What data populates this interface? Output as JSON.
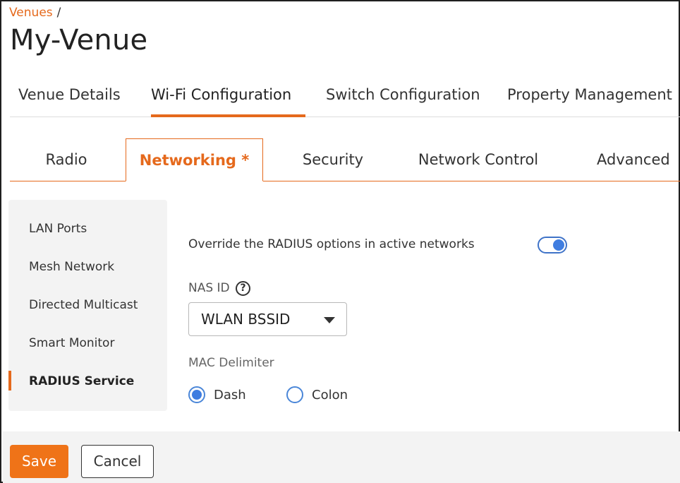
{
  "breadcrumb": {
    "items": [
      "Venues"
    ],
    "separator": "/"
  },
  "page_title": "My-Venue",
  "main_tabs": {
    "items": [
      {
        "label": "Venue Details"
      },
      {
        "label": "Wi-Fi Configuration"
      },
      {
        "label": "Switch Configuration"
      },
      {
        "label": "Property Management"
      }
    ],
    "active_index": 1
  },
  "sub_tabs": {
    "items": [
      {
        "label": "Radio"
      },
      {
        "label": "Networking *"
      },
      {
        "label": "Security"
      },
      {
        "label": "Network Control"
      },
      {
        "label": "Advanced"
      }
    ],
    "active_index": 1
  },
  "side_menu": {
    "items": [
      {
        "label": "LAN Ports"
      },
      {
        "label": "Mesh Network"
      },
      {
        "label": "Directed Multicast"
      },
      {
        "label": "Smart Monitor"
      },
      {
        "label": "RADIUS Service"
      }
    ],
    "active_index": 4
  },
  "radius": {
    "override_label": "Override the RADIUS options in active networks",
    "override_enabled": true,
    "nas_id_label": "NAS ID",
    "nas_id_help_glyph": "?",
    "nas_id_value": "WLAN BSSID",
    "mac_delimiter_label": "MAC Delimiter",
    "mac_delimiter_options": [
      {
        "label": "Dash",
        "checked": true
      },
      {
        "label": "Colon",
        "checked": false
      }
    ]
  },
  "footer": {
    "save_label": "Save",
    "cancel_label": "Cancel"
  },
  "colors": {
    "accent": "#e5691c",
    "save_button": "#ef7318",
    "toggle_on": "#3f7de0",
    "panel_bg": "#f3f3f3"
  },
  "icons": {
    "help": "question-circle-icon",
    "dropdown": "caret-down-icon"
  }
}
